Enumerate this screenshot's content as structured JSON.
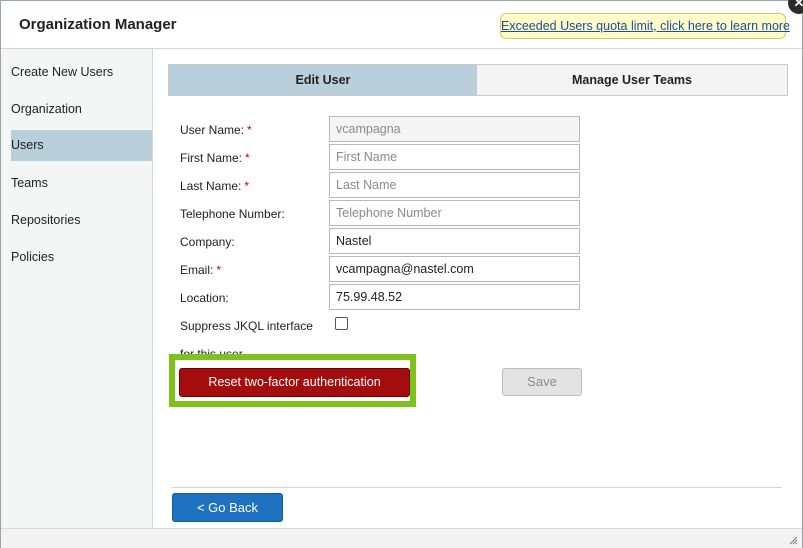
{
  "window": {
    "title": "Organization Manager",
    "quota_notice": "Exceeded Users quota limit, click here to learn more",
    "close_symbol": "✕"
  },
  "sidebar": {
    "items": [
      {
        "label": "Create New Users"
      },
      {
        "label": "Organization"
      },
      {
        "label": "Users"
      },
      {
        "label": "Teams"
      },
      {
        "label": "Repositories"
      },
      {
        "label": "Policies"
      }
    ],
    "active_item": "Users"
  },
  "tabs": [
    {
      "label": "Edit User"
    },
    {
      "label": "Manage User Teams"
    }
  ],
  "active_tab": "Edit User",
  "form": {
    "required_mark": "*",
    "username": {
      "label": "User Name:",
      "value": "vcampagna"
    },
    "first_name": {
      "label": "First Name:",
      "value": "",
      "placeholder": "First Name"
    },
    "last_name": {
      "label": "Last Name:",
      "value": "",
      "placeholder": "Last Name"
    },
    "telephone": {
      "label": "Telephone Number:",
      "value": "",
      "placeholder": "Telephone Number"
    },
    "company": {
      "label": "Company:",
      "value": "Nastel"
    },
    "email": {
      "label": "Email:",
      "value": "vcampagna@nastel.com"
    },
    "location": {
      "label": "Location:",
      "value": "75.99.48.52"
    },
    "suppress": {
      "label_line1": "Suppress JKQL interface",
      "label_line2": "for this user",
      "checked": false
    }
  },
  "buttons": {
    "reset_2fa": "Reset two-factor authentication",
    "save": "Save",
    "go_back": "< Go Back"
  },
  "colors": {
    "highlight": "#7ec21b",
    "reset_button": "#a30d0d",
    "go_back_button": "#1e72c0",
    "active_tab": "#b9cfdc",
    "active_sidebar": "#b8cfd9"
  }
}
